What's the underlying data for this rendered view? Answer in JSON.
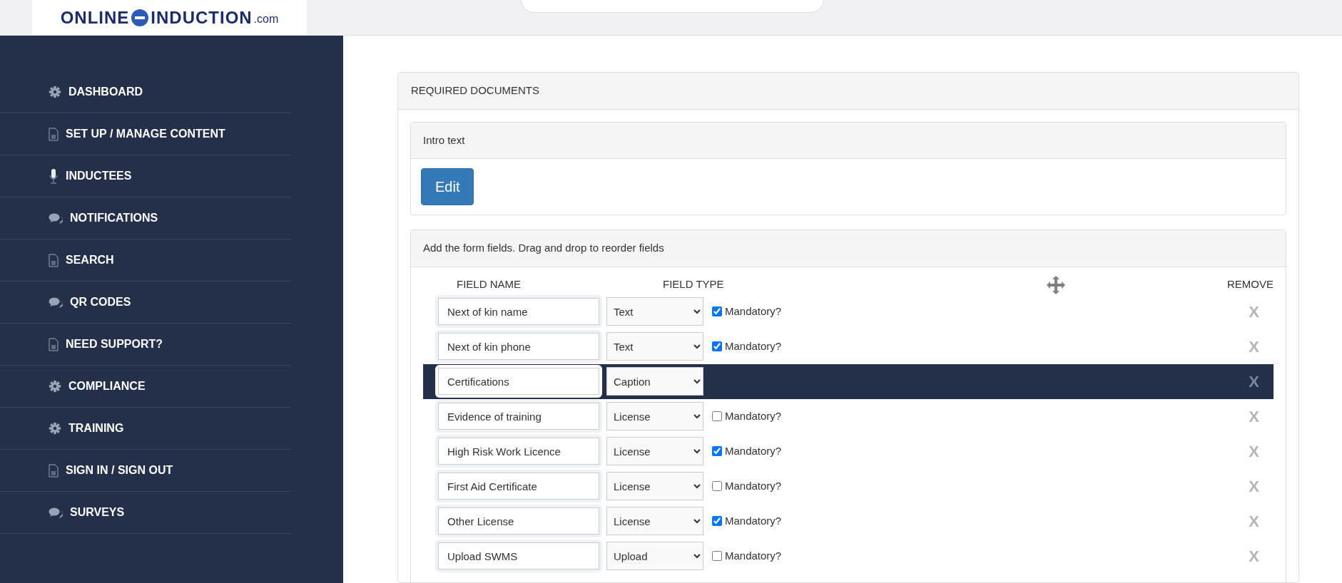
{
  "logo": {
    "left": "ONLINE",
    "right": "INDUCTION",
    ".com": ".com"
  },
  "sidebar": {
    "items": [
      {
        "label": "DASHBOARD",
        "kind": "gear"
      },
      {
        "label": "SET UP / MANAGE CONTENT",
        "kind": "document"
      },
      {
        "label": "INDUCTEES",
        "kind": "microphone"
      },
      {
        "label": "NOTIFICATIONS",
        "kind": "chat"
      },
      {
        "label": "SEARCH",
        "kind": "document"
      },
      {
        "label": "QR CODES",
        "kind": "chat"
      },
      {
        "label": "NEED SUPPORT?",
        "kind": "document"
      },
      {
        "label": "COMPLIANCE",
        "kind": "gear"
      },
      {
        "label": "TRAINING",
        "kind": "gear"
      },
      {
        "label": "SIGN IN / SIGN OUT",
        "kind": "document"
      },
      {
        "label": "SURVEYS",
        "kind": "chat"
      }
    ]
  },
  "panel": {
    "title": "REQUIRED DOCUMENTS",
    "intro": {
      "title": "Intro text",
      "button": "Edit"
    },
    "form": {
      "title": "Add the form fields. Drag and drop to reorder fields",
      "columns": [
        "FIELD NAME",
        "FIELD TYPE",
        "REMOVE"
      ],
      "rows": [
        {
          "name": "Next of kin name",
          "type": "Text",
          "mandatory": true,
          "mandatory_label": "Mandatory?",
          "selected": false,
          "remove": "X"
        },
        {
          "name": "Next of kin phone",
          "type": "Text",
          "mandatory": true,
          "mandatory_label": "Mandatory?",
          "selected": false,
          "remove": "X"
        },
        {
          "name": "Certifications",
          "type": "Caption",
          "selected": true,
          "remove": "X"
        },
        {
          "name": "Evidence of training",
          "type": "License",
          "mandatory": false,
          "mandatory_label": "Mandatory?",
          "selected": false,
          "remove": "X"
        },
        {
          "name": "High Risk Work Licence",
          "type": "License",
          "mandatory": true,
          "mandatory_label": "Mandatory?",
          "selected": false,
          "remove": "X"
        },
        {
          "name": "First Aid Certificate",
          "type": "License",
          "mandatory": false,
          "mandatory_label": "Mandatory?",
          "selected": false,
          "remove": "X"
        },
        {
          "name": "Other License",
          "type": "License",
          "mandatory": true,
          "mandatory_label": "Mandatory?",
          "selected": false,
          "remove": "X"
        },
        {
          "name": "Upload SWMS",
          "type": "Upload",
          "mandatory": false,
          "mandatory_label": "Mandatory?",
          "selected": false,
          "remove": "X"
        }
      ]
    }
  }
}
